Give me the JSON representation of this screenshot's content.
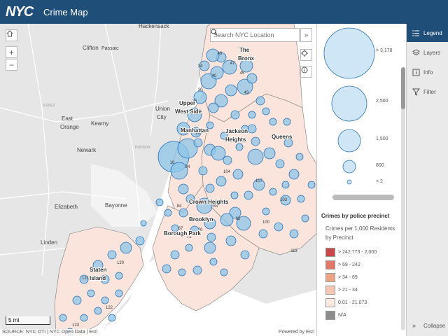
{
  "header": {
    "logo": "NYC",
    "title": "Crime Map"
  },
  "search": {
    "placeholder": "Search NYC Location"
  },
  "map": {
    "place_labels": [
      {
        "text": "Hackensack",
        "cls": "big"
      },
      {
        "text": "Clifton",
        "cls": "big"
      },
      {
        "text": "Passaic",
        "cls": "small"
      },
      {
        "text": "ESSEX",
        "cls": "county"
      },
      {
        "text": "East",
        "cls": "big"
      },
      {
        "text": "Orange",
        "cls": "big"
      },
      {
        "text": "Kearny",
        "cls": "big"
      },
      {
        "text": "Newark",
        "cls": "big"
      },
      {
        "text": "HUDSON",
        "cls": "county"
      },
      {
        "text": "Union",
        "cls": "big"
      },
      {
        "text": "City",
        "cls": "big"
      },
      {
        "text": "Elizabeth",
        "cls": "big"
      },
      {
        "text": "Bayonne",
        "cls": "big"
      },
      {
        "text": "Linden",
        "cls": "big"
      },
      {
        "text": "Upper",
        "cls": "boro"
      },
      {
        "text": "West Side",
        "cls": "boro"
      },
      {
        "text": "Manhattan",
        "cls": "boro"
      },
      {
        "text": "Jackson",
        "cls": "boro"
      },
      {
        "text": "Heights",
        "cls": "boro"
      },
      {
        "text": "Queens",
        "cls": "boro"
      },
      {
        "text": "The",
        "cls": "boro"
      },
      {
        "text": "Bronx",
        "cls": "boro"
      },
      {
        "text": "Crown Heights",
        "cls": "boro"
      },
      {
        "text": "Brooklyn",
        "cls": "boro"
      },
      {
        "text": "Borough Park",
        "cls": "boro"
      },
      {
        "text": "Staten",
        "cls": "boro"
      },
      {
        "text": "Island",
        "cls": "boro"
      }
    ],
    "precinct_labels": [
      "46",
      "47",
      "45",
      "40",
      "43",
      "34",
      "26",
      "30",
      "19",
      "10",
      "104",
      "107",
      "103",
      "113",
      "83",
      "84",
      "94",
      "67",
      "70",
      "71",
      "120",
      "121",
      "122",
      "123",
      "62",
      "100"
    ],
    "scale": "5 mi",
    "attribution": "SOURCE: NYC OTI | NYC Open Data | Esri",
    "powered_by": "Powered by Esri",
    "colors": {
      "circle_fill": "#8ec5e8",
      "circle_stroke": "#2b74b5",
      "precinct_fill": "#fbe4dc",
      "land": "#e6e6e6",
      "water": "#ffffff"
    }
  },
  "legend": {
    "size_labels": [
      "> 3,178",
      "2,500",
      "1,500",
      "800",
      "< 2"
    ],
    "title": "Crimes by police precinct",
    "subtitle": "Crimes per 1,000 Residents by Precinct",
    "classes": [
      {
        "label": "> 242.773 - 2,000",
        "color": "#c8484a"
      },
      {
        "label": "> 69 - 242",
        "color": "#e07a68"
      },
      {
        "label": "> 34 - 69",
        "color": "#f0a486"
      },
      {
        "label": "> 21 - 34",
        "color": "#f8c7b1"
      },
      {
        "label": "0.01 - 21.073",
        "color": "#fde9df"
      },
      {
        "label": "N/A",
        "color": "#8c8c8c"
      }
    ]
  },
  "nav": {
    "items": [
      {
        "label": "Legend",
        "icon": "list-icon",
        "active": true
      },
      {
        "label": "Layers",
        "icon": "layers-icon",
        "active": false
      },
      {
        "label": "Info",
        "icon": "info-icon",
        "active": false
      },
      {
        "label": "Filter",
        "icon": "filter-icon",
        "active": false
      }
    ],
    "collapse": "Collapse"
  }
}
